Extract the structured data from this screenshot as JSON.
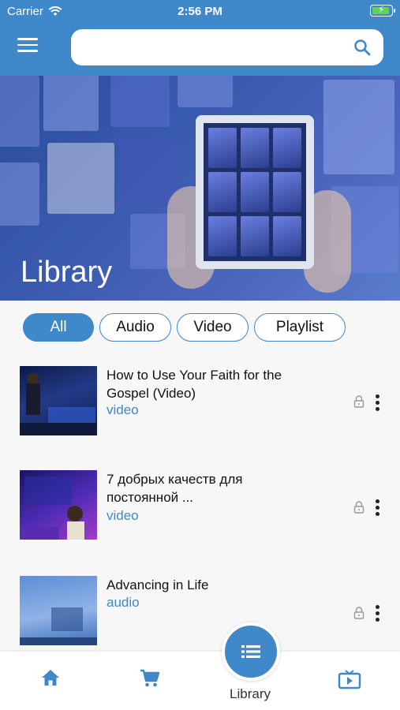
{
  "status": {
    "carrier": "Carrier",
    "time": "2:56 PM"
  },
  "search": {
    "placeholder": "",
    "value": ""
  },
  "hero": {
    "title": "Library"
  },
  "filters": [
    {
      "label": "All",
      "active": true
    },
    {
      "label": "Audio",
      "active": false
    },
    {
      "label": "Video",
      "active": false
    },
    {
      "label": "Playlist",
      "active": false
    }
  ],
  "items": [
    {
      "title": "How to Use Your Faith for the Gospel (Video)",
      "type": "video"
    },
    {
      "title": "7 добрых качеств для постоянной ...",
      "type": "video"
    },
    {
      "title": "Advancing in Life",
      "type": "audio"
    }
  ],
  "tabbar": {
    "active_label": "Library"
  },
  "colors": {
    "accent": "#3f88c9",
    "header": "#3f88c9",
    "battery": "#5fd35a"
  },
  "icons": [
    "wifi-icon",
    "battery-icon",
    "menu-icon",
    "search-icon",
    "lock-icon",
    "more-vertical-icon",
    "home-icon",
    "cart-icon",
    "list-icon",
    "tv-icon"
  ]
}
